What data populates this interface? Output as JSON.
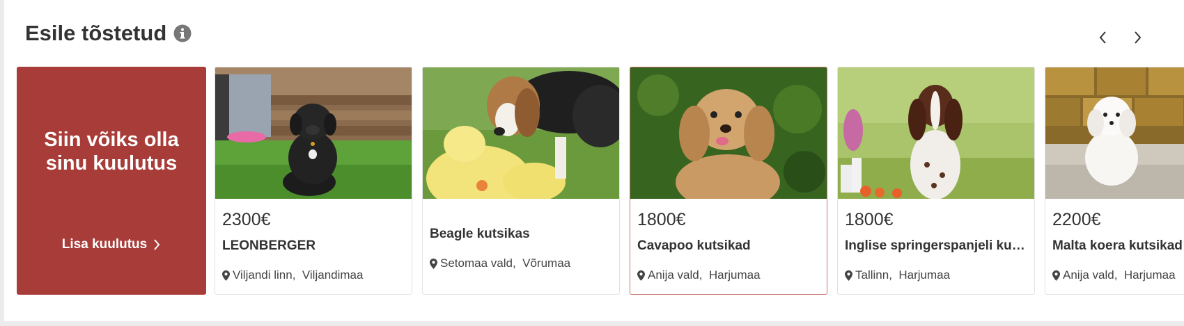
{
  "section": {
    "title": "Esile tõstetud"
  },
  "promo": {
    "line1": "Siin võiks olla",
    "line2": "sinu kuulutus",
    "link_label": "Lisa kuulutus"
  },
  "listings": [
    {
      "price": "2300€",
      "title": "LEONBERGER",
      "city": "Viljandi linn,",
      "region": "Viljandimaa",
      "photo": "black-puppy-on-grass"
    },
    {
      "price": "",
      "title": "Beagle kutsikas",
      "city": "Setomaa vald,",
      "region": "Võrumaa",
      "photo": "beagle-with-plush-toy"
    },
    {
      "price": "1800€",
      "title": "Cavapoo kutsikad",
      "city": "Anija vald,",
      "region": "Harjumaa",
      "photo": "cavapoo-puppy"
    },
    {
      "price": "1800€",
      "title": "Inglise springerspanjeli kut…",
      "city": "Tallinn,",
      "region": "Harjumaa",
      "photo": "springer-spaniel-puppy"
    },
    {
      "price": "2200€",
      "title": "Malta koera kutsikad",
      "city": "Anija vald,",
      "region": "Harjumaa",
      "photo": "maltese-puppy"
    }
  ],
  "colors": {
    "promo_bg": "#a83c38",
    "highlight_border": "#c5706b",
    "text": "#333333"
  }
}
